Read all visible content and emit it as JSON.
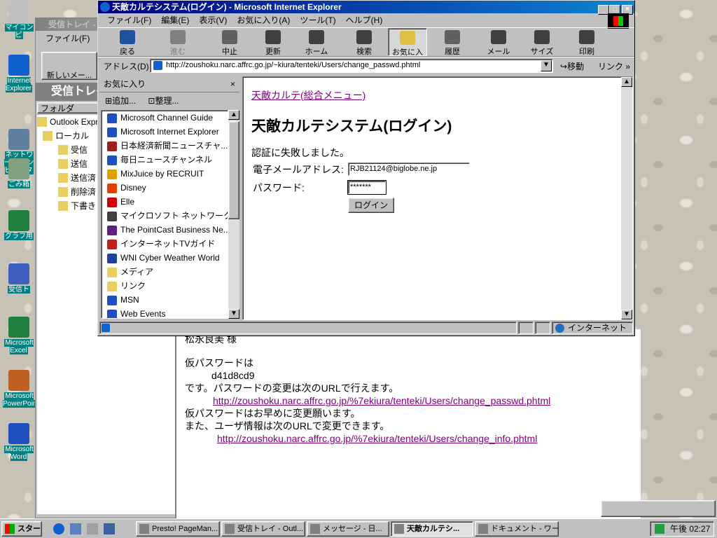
{
  "desktop_icons": [
    {
      "label": "マイコンピ",
      "color": "#c0c0c0"
    },
    {
      "label": "Internet Explorer",
      "color": "#1060d0"
    },
    {
      "label": "ネットワーク コンピュータ",
      "color": "#6080a0"
    },
    {
      "label": "ごみ箱",
      "color": "#80a080"
    },
    {
      "label": "グラフ用",
      "color": "#208040"
    },
    {
      "label": "受信ト",
      "color": "#4060c0"
    },
    {
      "label": "Microsoft Excel",
      "color": "#208040"
    },
    {
      "label": "Microsoft PowerPoint",
      "color": "#c06020"
    },
    {
      "label": "Microsoft Word",
      "color": "#2050c0"
    }
  ],
  "outlook": {
    "title": "受信トレイ - Outlook",
    "menu_file": "ファイル(F)",
    "new_mail": "新しいメー...",
    "folder_header": "受信トレイ",
    "folder_label": "フォルダ",
    "tree": [
      "Outlook Expr",
      "ローカル",
      "受信",
      "送信",
      "送信済",
      "削除済",
      "下書き"
    ]
  },
  "message": {
    "sender_line": "松永良美 様",
    "line1": "仮パスワードは",
    "password": "d41d8cd9",
    "line2": "です。パスワードの変更は次のURLで行えます。",
    "link1": "http://zoushoku.narc.affrc.go.jp/%7ekiura/tenteki/Users/change_passwd.phtml",
    "line3": "仮パスワードはお早めに変更願います。",
    "line4": "また、ユーザ情報は次のURLで変更できます。",
    "link2": "http://zoushoku.narc.affrc.go.jp/%7ekiura/tenteki/Users/change_info.phtml"
  },
  "ie": {
    "title": "天敵カルテシステム(ログイン) - Microsoft Internet Explorer",
    "menu": [
      "ファイル(F)",
      "編集(E)",
      "表示(V)",
      "お気に入り(A)",
      "ツール(T)",
      "ヘルプ(H)"
    ],
    "toolbar": [
      {
        "label": "戻る",
        "icon": "back-arrow-icon"
      },
      {
        "label": "進む",
        "icon": "forward-arrow-icon"
      },
      {
        "label": "中止",
        "icon": "stop-icon"
      },
      {
        "label": "更新",
        "icon": "refresh-icon"
      },
      {
        "label": "ホーム",
        "icon": "home-icon"
      },
      {
        "label": "検索",
        "icon": "search-icon"
      },
      {
        "label": "お気に入り",
        "icon": "favorites-icon"
      },
      {
        "label": "履歴",
        "icon": "history-icon"
      },
      {
        "label": "メール",
        "icon": "mail-icon"
      },
      {
        "label": "サイズ",
        "icon": "font-size-icon"
      },
      {
        "label": "印刷",
        "icon": "print-icon"
      }
    ],
    "address_label": "アドレス(D)",
    "address_value": "http://zoushoku.narc.affrc.go.jp/~kiura/tenteki/Users/change_passwd.phtml",
    "go_label": "移動",
    "links_label": "リンク",
    "favorites": {
      "title": "お気に入り",
      "add": "追加...",
      "organize": "整理...",
      "items": [
        {
          "label": "Microsoft Channel Guide",
          "color": "#2050c0"
        },
        {
          "label": "Microsoft Internet Explorer",
          "color": "#2050c0"
        },
        {
          "label": "日本経済新聞ニュースチャ...",
          "color": "#a02020"
        },
        {
          "label": "毎日ニュースチャンネル",
          "color": "#2050c0"
        },
        {
          "label": "MixJuice by RECRUIT",
          "color": "#e0a000"
        },
        {
          "label": "Disney",
          "color": "#e04000"
        },
        {
          "label": "Elle",
          "color": "#d00000"
        },
        {
          "label": "マイクロソフト ネットワーク",
          "color": "#404040"
        },
        {
          "label": "The PointCast Business Ne...",
          "color": "#602080"
        },
        {
          "label": "インターネットTVガイド",
          "color": "#c02020"
        },
        {
          "label": "WNI Cyber Weather World",
          "color": "#2040a0"
        },
        {
          "label": "メディア",
          "color": "#e8d060"
        },
        {
          "label": "リンク",
          "color": "#e8d060"
        },
        {
          "label": "MSN",
          "color": "#2050c0"
        },
        {
          "label": "Web Events",
          "color": "#2050c0"
        }
      ]
    },
    "page": {
      "top_link": "天敵カルテ(総合メニュー)",
      "heading": "天敵カルテシステム(ログイン)",
      "error": "認証に失敗しました。",
      "email_label": "電子メールアドレス:",
      "email_value": "RJB21124@biglobe.ne.jp",
      "password_label": "パスワード:",
      "password_value": "*******",
      "login_button": "ログイン"
    },
    "status_zone": "インターネット"
  },
  "taskbar": {
    "start": "スタート",
    "tasks": [
      "Presto! PageMan...",
      "受信トレイ - Outl...",
      "メッセージ - 日...",
      "天敵カルテシ...",
      "ドキュメント - ワードパ..."
    ],
    "clock": "午後 02:27"
  }
}
